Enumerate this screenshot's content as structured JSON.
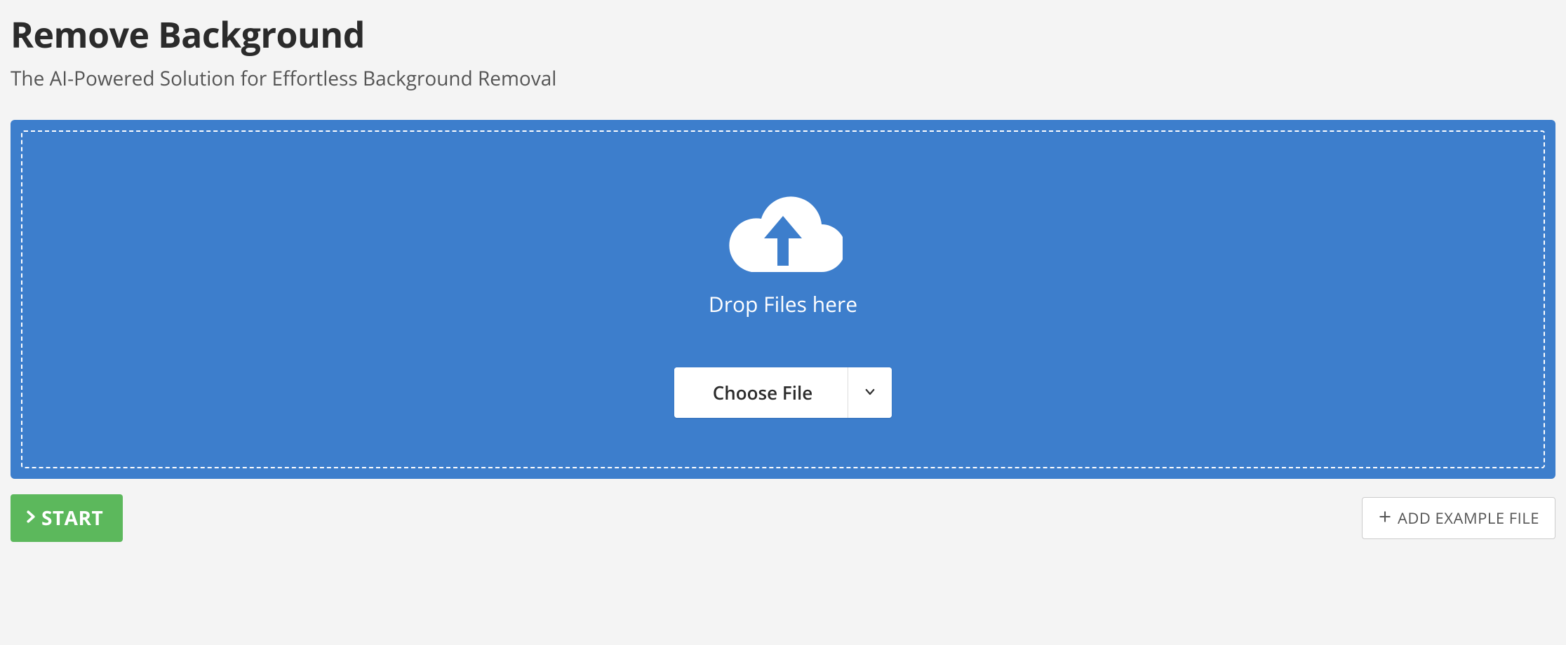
{
  "header": {
    "title": "Remove Background",
    "subtitle": "The AI-Powered Solution for Effortless Background Removal"
  },
  "dropzone": {
    "drop_text": "Drop Files here",
    "choose_file_label": "Choose File"
  },
  "actions": {
    "start_label": "START",
    "add_example_label": "ADD EXAMPLE FILE"
  },
  "colors": {
    "dropzone_bg": "#3d7ecc",
    "start_btn_bg": "#5cb85c"
  }
}
